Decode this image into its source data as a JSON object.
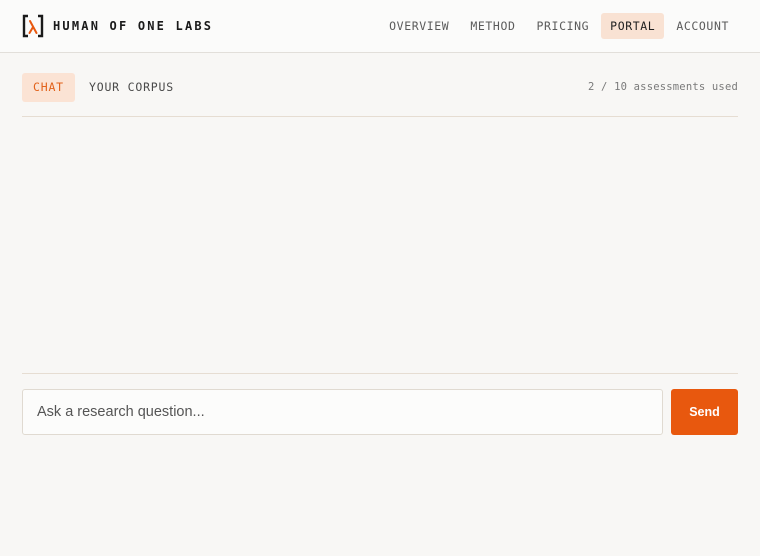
{
  "brand": {
    "name": "HUMAN OF ONE LABS",
    "logo_icon": "bracket-lambda-icon",
    "accent_color": "#e8580e"
  },
  "nav": {
    "items": [
      {
        "label": "OVERVIEW",
        "active": false
      },
      {
        "label": "METHOD",
        "active": false
      },
      {
        "label": "PRICING",
        "active": false
      },
      {
        "label": "PORTAL",
        "active": true
      },
      {
        "label": "ACCOUNT",
        "active": false
      }
    ]
  },
  "tabs": [
    {
      "label": "CHAT",
      "active": true
    },
    {
      "label": "YOUR CORPUS",
      "active": false
    }
  ],
  "usage": {
    "text": "2 / 10 assessments used"
  },
  "composer": {
    "placeholder": "Ask a research question...",
    "value": "",
    "send_label": "Send"
  }
}
